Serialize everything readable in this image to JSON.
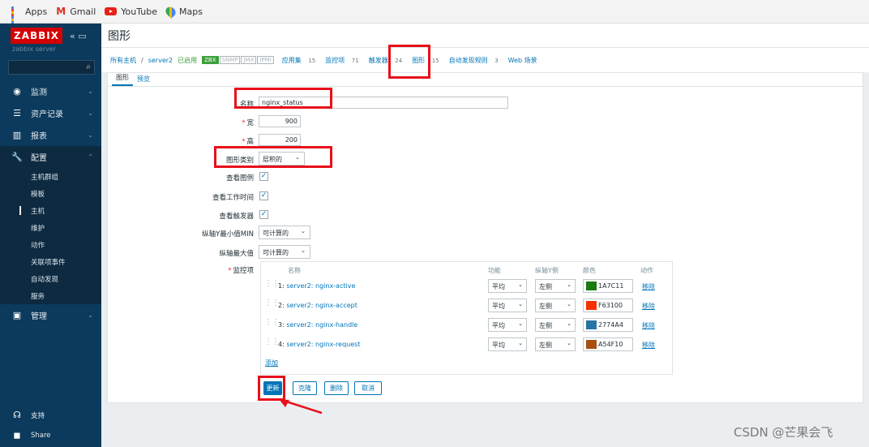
{
  "bookmarks": [
    "Apps",
    "Gmail",
    "YouTube",
    "Maps"
  ],
  "sidebar": {
    "logo": "ZABBIX",
    "collapse": "«",
    "server": "zabbix server",
    "menu": [
      {
        "label": "监测",
        "icon": "eye-icon"
      },
      {
        "label": "资产记录",
        "icon": "list-icon"
      },
      {
        "label": "报表",
        "icon": "chart-icon"
      },
      {
        "label": "配置",
        "icon": "wrench-icon"
      }
    ],
    "submenu": [
      "主机群组",
      "模板",
      "主机",
      "维护",
      "动作",
      "关联项事件",
      "自动发现",
      "服务"
    ],
    "admin": "管理",
    "support": "支持",
    "share": "Share"
  },
  "page": {
    "title": "图形",
    "breadcrumb": {
      "all_hosts": "所有主机",
      "sep": "/",
      "host": "server2",
      "enabled": "已启用",
      "tags": [
        "ZBX",
        "SNMP",
        "JMX",
        "IPMI"
      ],
      "apps": "应用集",
      "apps_count": "15",
      "items": "监控项",
      "items_count": "71",
      "triggers": "触发器",
      "triggers_count": "24",
      "graphs": "图形",
      "graphs_count": "15",
      "discovery": "自动发现规则",
      "discovery_count": "3",
      "web": "Web 场景"
    },
    "tabs": [
      "图形",
      "预览"
    ]
  },
  "form": {
    "name_label": "名称",
    "name_value": "nginx_status",
    "width_label": "宽",
    "width_value": "900",
    "height_label": "高",
    "height_value": "200",
    "type_label": "图形类别",
    "type_value": "层积的",
    "legend_label": "查看图例",
    "worktime_label": "查看工作时间",
    "triggers_label": "查看触发器",
    "ymin_label": "纵轴Y最小值MIN",
    "ymin_value": "可计算的",
    "ymax_label": "纵轴最大值",
    "ymax_value": "可计算的",
    "items_label": "监控项",
    "items_headers": {
      "name": "名称",
      "func": "功能",
      "axis": "纵轴Y侧",
      "color": "颜色",
      "action": "动作"
    },
    "items": [
      {
        "idx": "1:",
        "name": "server2: nginx-active",
        "func": "平均",
        "axis": "左侧",
        "color": "1A7C11",
        "swatch": "#1a7c11",
        "remove": "移除"
      },
      {
        "idx": "2:",
        "name": "server2: nginx-accept",
        "func": "平均",
        "axis": "左侧",
        "color": "F63100",
        "swatch": "#f63100",
        "remove": "移除"
      },
      {
        "idx": "3:",
        "name": "server2: nginx-handle",
        "func": "平均",
        "axis": "左侧",
        "color": "2774A4",
        "swatch": "#2774a4",
        "remove": "移除"
      },
      {
        "idx": "4:",
        "name": "server2: nginx-request",
        "func": "平均",
        "axis": "左侧",
        "color": "A54F10",
        "swatch": "#a54f10",
        "remove": "移除"
      }
    ],
    "add_label": "添加",
    "buttons": {
      "update": "更新",
      "clone": "克隆",
      "delete": "删除",
      "cancel": "取消"
    }
  },
  "watermark": "CSDN @芒果会飞"
}
